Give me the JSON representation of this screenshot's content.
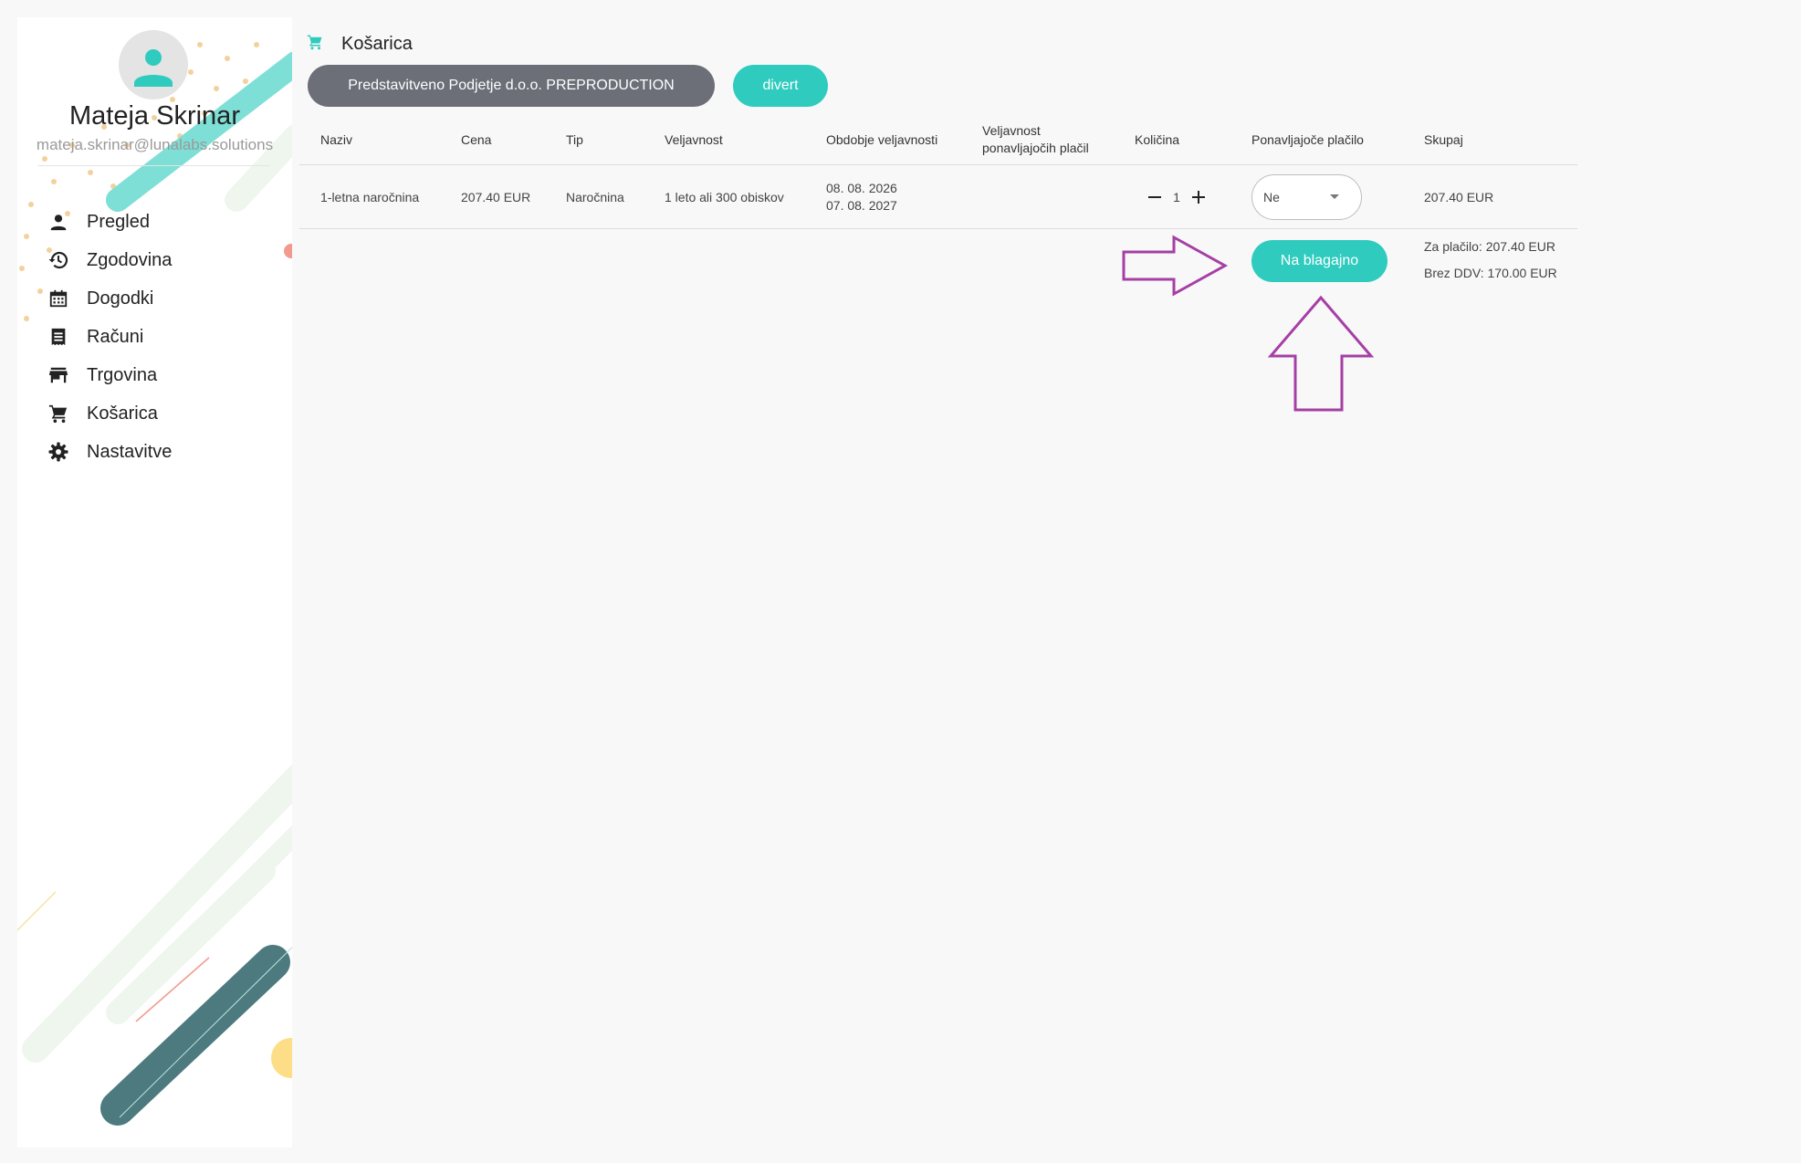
{
  "user": {
    "name": "Mateja Skrinar",
    "email": "mateja.skrinar@lunalabs.solutions"
  },
  "sidebar": {
    "items": [
      {
        "label": "Pregled",
        "icon": "person-icon"
      },
      {
        "label": "Zgodovina",
        "icon": "history-icon"
      },
      {
        "label": "Dogodki",
        "icon": "calendar-icon"
      },
      {
        "label": "Računi",
        "icon": "receipt-icon"
      },
      {
        "label": "Trgovina",
        "icon": "store-icon"
      },
      {
        "label": "Košarica",
        "icon": "cart-icon"
      },
      {
        "label": "Nastavitve",
        "icon": "gear-icon"
      }
    ]
  },
  "header": {
    "title": "Košarica",
    "icon": "cart-icon"
  },
  "toolbar": {
    "company_label": "Predstavitveno Podjetje d.o.o. PREPRODUCTION",
    "divert_label": "divert"
  },
  "table": {
    "columns": [
      "Naziv",
      "Cena",
      "Tip",
      "Veljavnost",
      "Obdobje veljavnosti",
      "Veljavnost",
      "ponavljajočih plačil",
      "Količina",
      "Ponavljajoče plačilo",
      "Skupaj"
    ],
    "rows": [
      {
        "name": "1-letna naročnina",
        "price": "207.40 EUR",
        "type": "Naročnina",
        "validity": "1 leto ali 300 obiskov",
        "period_start": "08. 08. 2026",
        "period_end": "07. 08. 2027",
        "quantity": "1",
        "recurring": "Ne",
        "total": "207.40 EUR"
      }
    ]
  },
  "checkout": {
    "button_label": "Na blagajno",
    "to_pay": "Za plačilo: 207.40 EUR",
    "without_vat": "Brez DDV: 170.00 EUR"
  },
  "colors": {
    "accent": "#2fcbbe",
    "company_button": "#6c6f78",
    "annotation_arrow": "#a53fa5"
  }
}
